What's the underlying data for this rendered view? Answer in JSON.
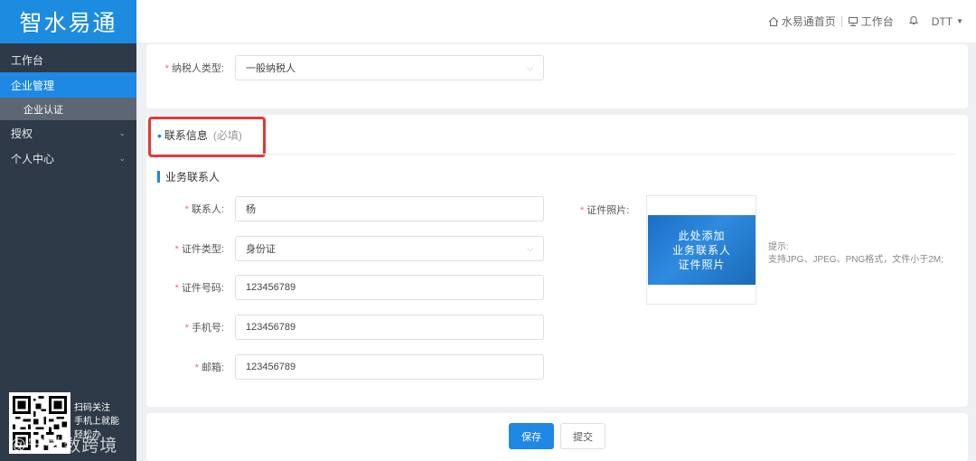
{
  "logo": {
    "text": "智水易通"
  },
  "sidebar": {
    "items": [
      {
        "label": "工作台"
      },
      {
        "label": "企业管理"
      },
      {
        "label": "企业认证"
      },
      {
        "label": "授权",
        "caret": "⌄"
      },
      {
        "label": "个人中心",
        "caret": "⌄"
      }
    ],
    "qr_text": [
      "扫码关注",
      "手机上就能",
      "轻松办"
    ],
    "watermark": "@安徽数跨境"
  },
  "header": {
    "home_label": "水易通首页",
    "workbench_label": "工作台",
    "user_label": "DTT",
    "icons": [
      "home-icon",
      "monitor-icon",
      "bell-icon",
      "chevron-down-icon"
    ]
  },
  "taxpayer": {
    "label": "纳税人类型:",
    "value": "一般纳税人"
  },
  "contact": {
    "section_title": "联系信息",
    "section_hint": "(必填)",
    "subsection_title": "业务联系人",
    "fields": {
      "name": {
        "label": "联系人:",
        "value": "杨"
      },
      "id_type": {
        "label": "证件类型:",
        "value": "身份证"
      },
      "id_number": {
        "label": "证件号码:",
        "value": "123456789"
      },
      "phone": {
        "label": "手机号:",
        "value": "123456789"
      },
      "email": {
        "label": "邮箱:",
        "value": "123456789"
      }
    },
    "photo": {
      "label": "证件照片:",
      "upload_lines": [
        "此处添加",
        "业务联系人",
        "证件照片"
      ],
      "tip_title": "提示:",
      "tip_text": "支持JPG、JPEG、PNG格式，文件小于2M;"
    }
  },
  "actions": {
    "save": "保存",
    "submit": "提交"
  },
  "colors": {
    "primary": "#1e88e5",
    "sidebar": "#2e3a48",
    "required": "#f56c6c",
    "highlight": "#e53935"
  }
}
